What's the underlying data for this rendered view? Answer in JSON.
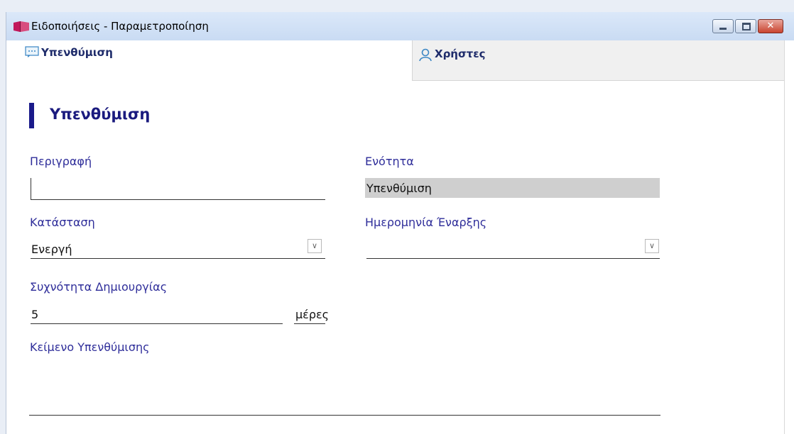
{
  "window": {
    "title": "Ειδοποιήσεις - Παραμετροποίηση"
  },
  "tabs": [
    {
      "label": "Υπενθύμιση",
      "icon": "reminder-icon"
    },
    {
      "label": "Χρήστες",
      "icon": "user-icon"
    }
  ],
  "form": {
    "heading": "Υπενθύμιση",
    "description": {
      "label": "Περιγραφή",
      "value": ""
    },
    "section": {
      "label": "Ενότητα",
      "value": "Υπενθύμιση"
    },
    "status": {
      "label": "Κατάσταση",
      "value": "Ενεργή"
    },
    "start_date": {
      "label": "Ημερομηνία Έναρξης",
      "value": ""
    },
    "frequency": {
      "label": "Συχνότητα Δημιουργίας",
      "value": "5",
      "unit": "μέρες"
    },
    "reminder_text": {
      "label": "Κείμενο Υπενθύμισης",
      "value": ""
    }
  },
  "colors": {
    "accent": "#1a1a8a",
    "label": "#2f2e9a",
    "close": "#c9442f"
  }
}
